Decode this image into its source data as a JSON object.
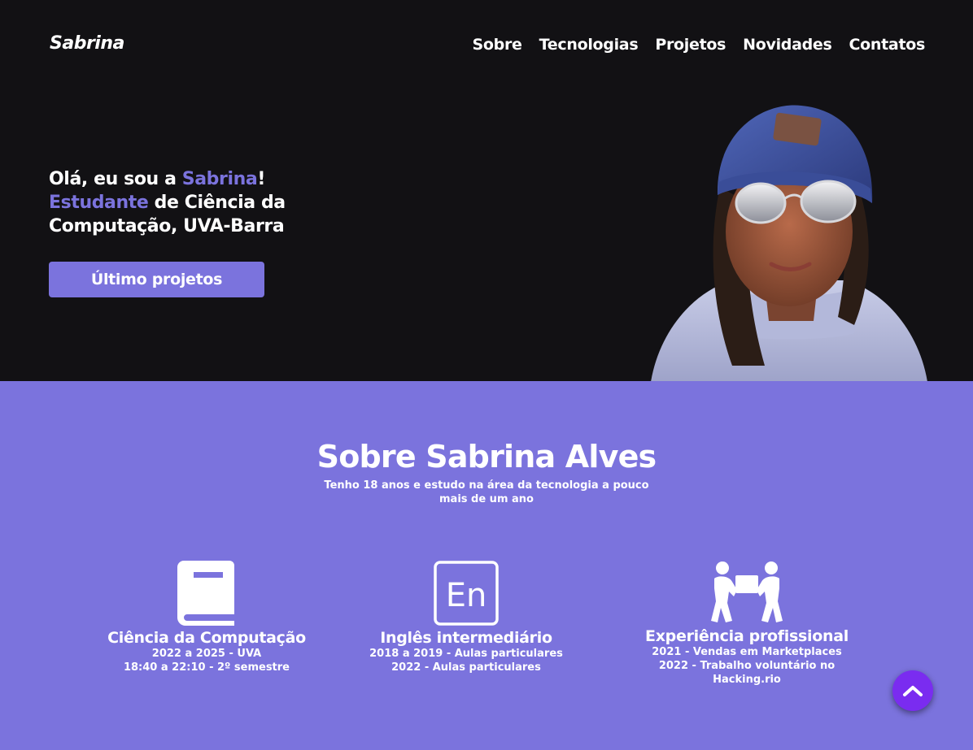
{
  "header": {
    "logo": "Sabrina",
    "nav": [
      "Sobre",
      "Tecnologias",
      "Projetos",
      "Novidades",
      "Contatos"
    ]
  },
  "hero": {
    "line1_pre": "Olá, eu sou a ",
    "line1_name": "Sabrina",
    "line1_post": "!",
    "line2_accent": "Estudante",
    "line2_rest": " de Ciência da",
    "line3": "Computação, UVA-Barra",
    "cta_label": "Último projetos",
    "avatar_icon": "avatar-3d-girl-beanie-sunglasses"
  },
  "about": {
    "title": "Sobre Sabrina Alves",
    "subtitle_line1": "Tenho 18 anos e estudo na área da tecnologia a pouco",
    "subtitle_line2": "mais de um ano",
    "cards": [
      {
        "icon": "book-icon",
        "title": "Ciência da Computação",
        "lines": [
          "2022 a 2025 - UVA",
          "18:40 a 22:10 - 2º semestre"
        ]
      },
      {
        "icon": "english-en-icon",
        "title": "Inglês intermediário",
        "lines": [
          "2018 a 2019 - Aulas particulares",
          "2022 - Aulas particulares"
        ]
      },
      {
        "icon": "people-carrying-box-icon",
        "title": "Experiência profissional",
        "lines": [
          "2021 - Vendas em Marketplaces",
          "2022 - Trabalho voluntário no Hacking.rio"
        ]
      }
    ]
  },
  "scroll_top": {
    "icon": "chevron-up-icon"
  },
  "colors": {
    "accent": "#7b73dd",
    "hero_bg": "#121114",
    "scroll_button": "#7a2cf0"
  }
}
